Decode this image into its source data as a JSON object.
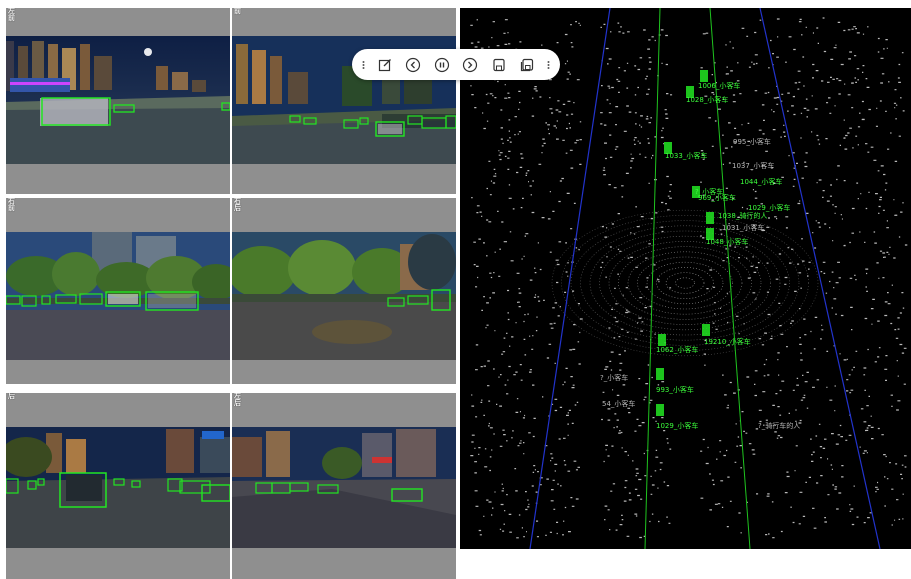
{
  "cameras": [
    {
      "id": "front-left",
      "label": "左前"
    },
    {
      "id": "front",
      "label": "前"
    },
    {
      "id": "right-front",
      "label": "右前"
    },
    {
      "id": "right-rear",
      "label": "右后"
    },
    {
      "id": "rear",
      "label": "后"
    },
    {
      "id": "left-rear",
      "label": "左后"
    }
  ],
  "toolbar": {
    "buttons": [
      {
        "name": "edit-button",
        "icon": "edit-icon"
      },
      {
        "name": "prev-button",
        "icon": "chevron-left-icon"
      },
      {
        "name": "pause-button",
        "icon": "pause-icon"
      },
      {
        "name": "next-button",
        "icon": "chevron-right-icon"
      },
      {
        "name": "save-button",
        "icon": "save-icon"
      },
      {
        "name": "save-all-button",
        "icon": "save-stack-icon"
      }
    ]
  },
  "lidar_objects": [
    {
      "text": "1006_小客车",
      "color": "#3cff3c"
    },
    {
      "text": "1028_小客车",
      "color": "#3cff3c"
    },
    {
      "text": "1033_小客车",
      "color": "#3cff3c"
    },
    {
      "text": "995_小客车",
      "color": "#b8b8b8"
    },
    {
      "text": "?_小客车",
      "color": "#3cff3c"
    },
    {
      "text": "1037_小客车",
      "color": "#b8b8b8"
    },
    {
      "text": "1044_小客车",
      "color": "#3cff3c"
    },
    {
      "text": "969_小客车",
      "color": "#3cff3c"
    },
    {
      "text": "1029_小客车",
      "color": "#3cff3c"
    },
    {
      "text": "1038_骑行的人",
      "color": "#3cff3c"
    },
    {
      "text": "1031_小客车",
      "color": "#b8b8b8"
    },
    {
      "text": "1048_小客车",
      "color": "#3cff3c"
    },
    {
      "text": "1062_小客车",
      "color": "#3cff3c"
    },
    {
      "text": "19210_小客车",
      "color": "#3cff3c"
    },
    {
      "text": "?_小客车",
      "color": "#b8b8b8"
    },
    {
      "text": "993_小客车",
      "color": "#3cff3c"
    },
    {
      "text": "54_小客车",
      "color": "#b8b8b8"
    },
    {
      "text": "1029_小客车",
      "color": "#3cff3c"
    },
    {
      "text": "?_骑行车的人",
      "color": "#b8b8b8"
    }
  ],
  "colors": {
    "box": "#22e622",
    "lane_green": "#1fc41f",
    "lane_blue": "#2233cc",
    "points": "#e8e8e8"
  }
}
